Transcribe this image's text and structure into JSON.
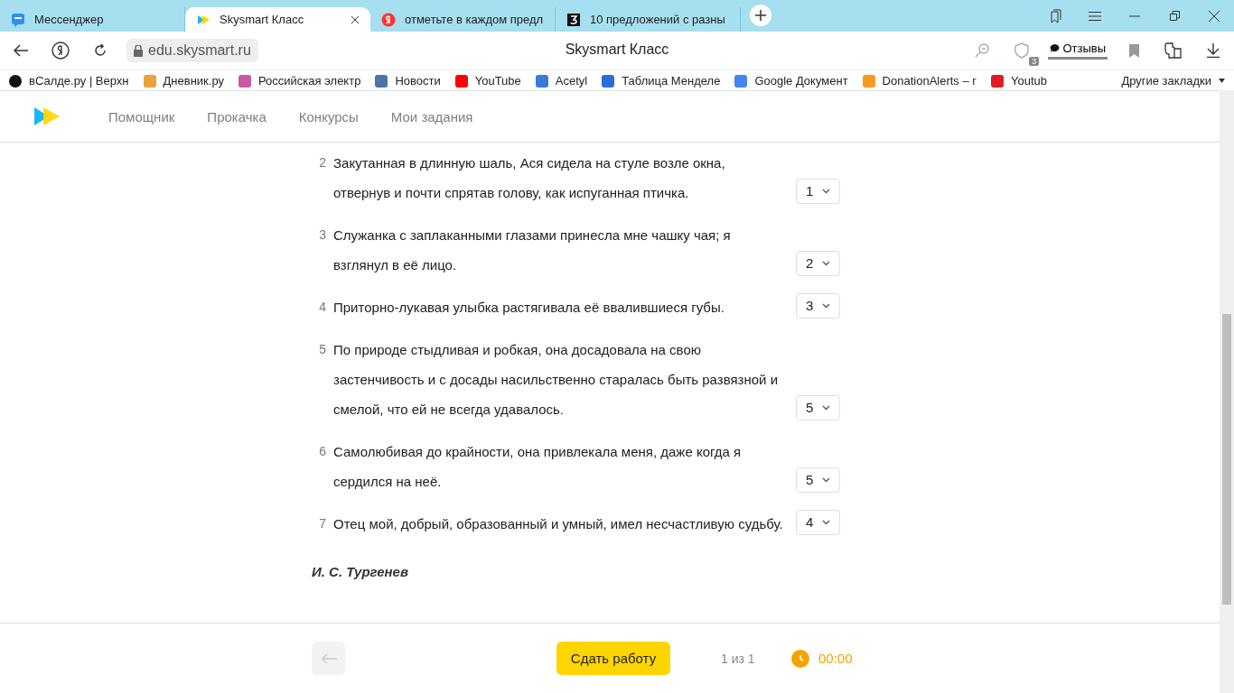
{
  "browser": {
    "tabs": [
      {
        "title": "Мессенджер",
        "selected": false
      },
      {
        "title": "Skysmart Класс",
        "selected": true
      },
      {
        "title": "отметьте в каждом предл",
        "selected": false
      },
      {
        "title": "10 предложений с разны",
        "selected": false
      }
    ],
    "address": "edu.skysmart.ru",
    "page_title": "Skysmart Класс",
    "reviews": "Отзывы",
    "shield_badge": "3",
    "bookmarks": [
      "вСалде.ру | Верхн",
      "Дневник.ру",
      "Российская электр",
      "Новости",
      "YouTube",
      "Acetyl",
      "Таблица Менделе",
      "Google Документ",
      "DonationAlerts – г",
      "Youtub"
    ],
    "other_bookmarks": "Другие закладки"
  },
  "site_nav": [
    "Помощник",
    "Прокачка",
    "Конкурсы",
    "Мои задания"
  ],
  "sentences": [
    {
      "number": "2",
      "text": "Закутанная в длинную шаль, Ася сидела на стуле возле окна, отвернув и почти спрятав голову, как испуганная птичка.",
      "answer": "1"
    },
    {
      "number": "3",
      "text": "Служанка с заплаканными глазами принесла мне чашку чая; я взглянул в её лицо.",
      "answer": "2"
    },
    {
      "number": "4",
      "text": "Приторно-лукавая улыбка растягивала её ввалившиеся губы.",
      "answer": "3"
    },
    {
      "number": "5",
      "text": "По природе стыдливая и робкая, она досадовала на свою застенчивость и с досады насильственно старалась быть развязной и смелой, что ей не всегда удавалось.",
      "answer": "5"
    },
    {
      "number": "6",
      "text": "Самолюбивая до крайности, она привлекала меня, даже когда я сердился на неё.",
      "answer": "5"
    },
    {
      "number": "7",
      "text": "Отец мой, добрый, образованный и умный, имел несчастливую судьбу.",
      "answer": "4"
    }
  ],
  "author": "И. С. Тургенев",
  "footer": {
    "back_disabled": true,
    "submit": "Сдать работу",
    "page": "1 из 1",
    "timer": "00:00"
  }
}
